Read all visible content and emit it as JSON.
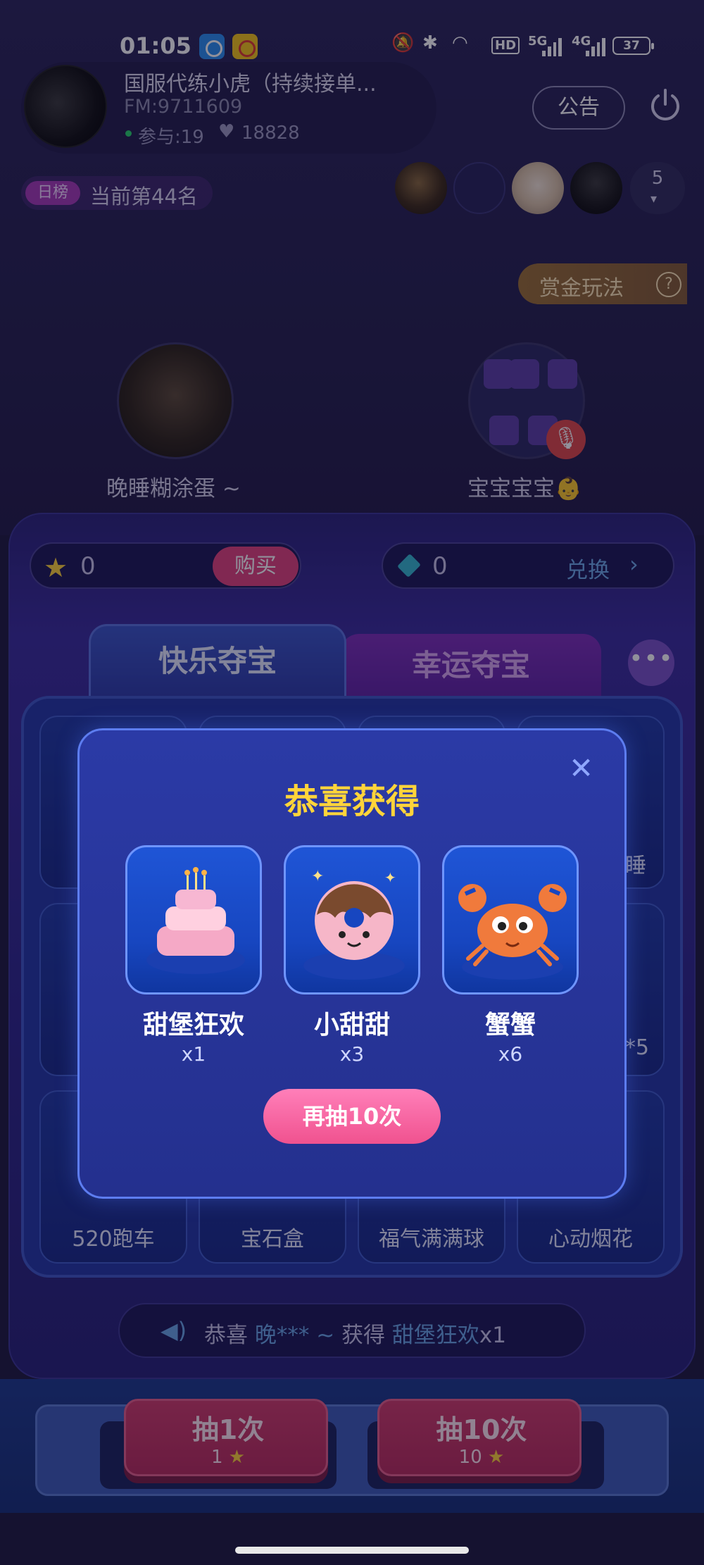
{
  "status_bar": {
    "time": "01:05",
    "hd": "HD",
    "network_1": "5G",
    "network_2": "4G",
    "battery": "37"
  },
  "host": {
    "name": "国服代练小虎（持续接单...",
    "fm": "FM:9711609",
    "participants": "参与:19",
    "likes": "18828"
  },
  "header": {
    "notice_label": "公告"
  },
  "rank": {
    "tag": "日榜",
    "text": "当前第44名"
  },
  "viewers": {
    "count": "5"
  },
  "bounty": {
    "label": "赏金玩法",
    "help": "?"
  },
  "seats": [
    {
      "name": "晚睡糊涂蛋 ~"
    },
    {
      "name": "宝宝宝宝👶"
    }
  ],
  "wallet": {
    "coins": "0",
    "buy_label": "购买",
    "crystals": "0",
    "exchange_label": "兑换"
  },
  "tabs": [
    {
      "label": "快乐夺宝",
      "active": true
    },
    {
      "label": "幸运夺宝",
      "active": false
    }
  ],
  "prize_board": {
    "visible_partial_labels": [
      "睡",
      "*5"
    ],
    "bottom_row": [
      "520跑车",
      "宝石盒",
      "福气满满球",
      "心动烟花"
    ]
  },
  "broadcast": {
    "prefix": "恭喜",
    "user": "晚*** ~",
    "verb": "获得",
    "item": "甜堡狂欢",
    "qty": "x1"
  },
  "draw_buttons": [
    {
      "title": "抽1次",
      "cost": "1"
    },
    {
      "title": "抽10次",
      "cost": "10"
    }
  ],
  "reward_modal": {
    "title": "恭喜获得",
    "rewards": [
      {
        "name": "甜堡狂欢",
        "count": "x1",
        "icon": "cake-icon"
      },
      {
        "name": "小甜甜",
        "count": "x3",
        "icon": "donut-icon"
      },
      {
        "name": "蟹蟹",
        "count": "x6",
        "icon": "crab-icon"
      }
    ],
    "redraw_label": "再抽10次"
  },
  "colors": {
    "accent_gold": "#ffd43a",
    "accent_pink": "#f0528f",
    "panel_blue": "#2437a6"
  }
}
